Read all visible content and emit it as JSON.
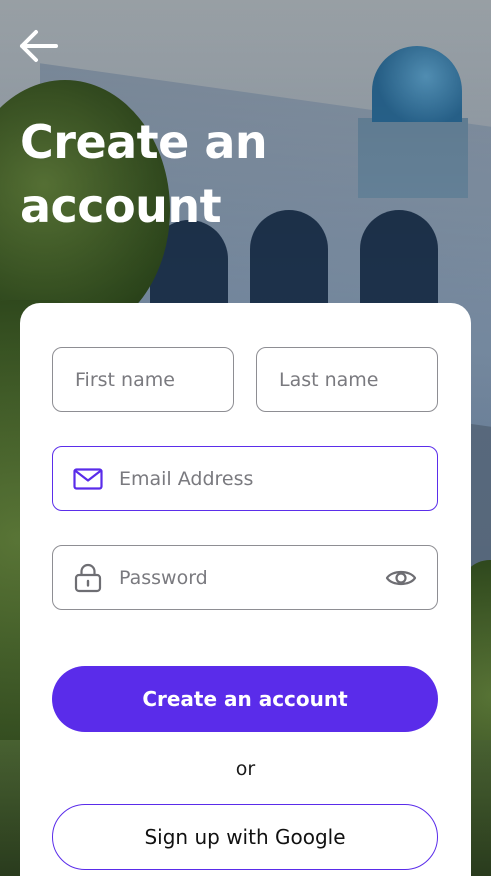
{
  "header": {
    "back_icon": "arrow-left-icon",
    "title": "Create an account"
  },
  "form": {
    "first_name": {
      "placeholder": "First name",
      "value": ""
    },
    "last_name": {
      "placeholder": "Last name",
      "value": ""
    },
    "email": {
      "placeholder": "Email Address",
      "value": "",
      "icon": "mail-icon"
    },
    "password": {
      "placeholder": "Password",
      "value": "",
      "icon": "lock-icon",
      "toggle_icon": "eye-icon"
    },
    "submit_label": "Create an account",
    "divider_text": "or",
    "google_label": "Sign up with Google"
  },
  "colors": {
    "accent": "#5a2cea",
    "card_background": "#ffffff",
    "title_text": "#ffffff",
    "field_border": "#8e8e93"
  }
}
